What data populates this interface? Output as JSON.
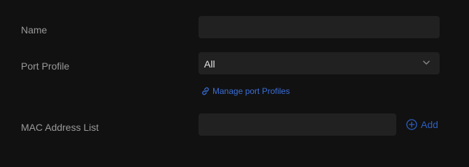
{
  "form": {
    "name": {
      "label": "Name",
      "value": ""
    },
    "port_profile": {
      "label": "Port Profile",
      "selected": "All",
      "manage_link": "Manage port Profiles"
    },
    "mac_address_list": {
      "label": "MAC Address List",
      "value": "",
      "add_label": "Add"
    }
  },
  "icons": {
    "chevron": "chevron-down-icon",
    "link": "link-icon",
    "add": "plus-circle-icon"
  },
  "colors": {
    "background": "#111111",
    "field": "#212121",
    "label": "#9a9a9a",
    "link": "#3b6fd8",
    "add": "#2f5fbf"
  }
}
